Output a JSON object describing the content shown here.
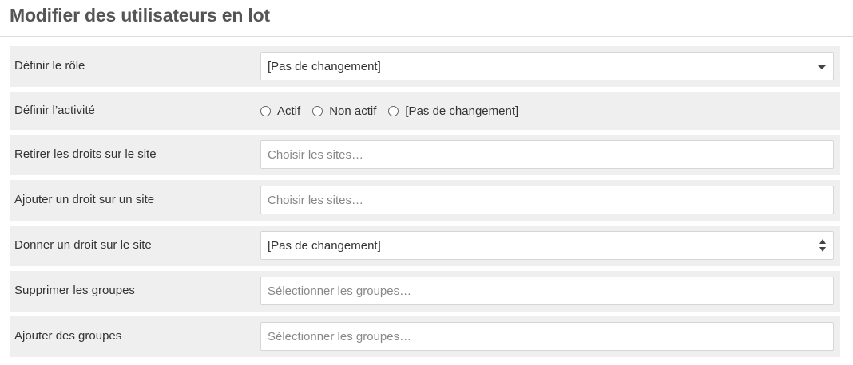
{
  "page": {
    "title": "Modifier des utilisateurs en lot"
  },
  "form": {
    "role": {
      "label": "Définir le rôle",
      "value": "[Pas de changement]"
    },
    "activity": {
      "label": "Définir l’activité",
      "options": [
        "Actif",
        "Non actif",
        "[Pas de changement]"
      ]
    },
    "remove_site_rights": {
      "label": "Retirer les droits sur le site",
      "placeholder": "Choisir les sites…"
    },
    "add_site_right": {
      "label": "Ajouter un droit sur un site",
      "placeholder": "Choisir les sites…"
    },
    "give_site_right": {
      "label": "Donner un droit sur le site",
      "value": "[Pas de changement]"
    },
    "remove_groups": {
      "label": "Supprimer les groupes",
      "placeholder": "Sélectionner les groupes…"
    },
    "add_groups": {
      "label": "Ajouter des groupes",
      "placeholder": "Sélectionner les groupes…"
    }
  },
  "icons": {
    "role_select": "caret-down-icon",
    "site_right_select": "spinner-arrows-icon",
    "radio": "radio-unchecked-icon"
  }
}
